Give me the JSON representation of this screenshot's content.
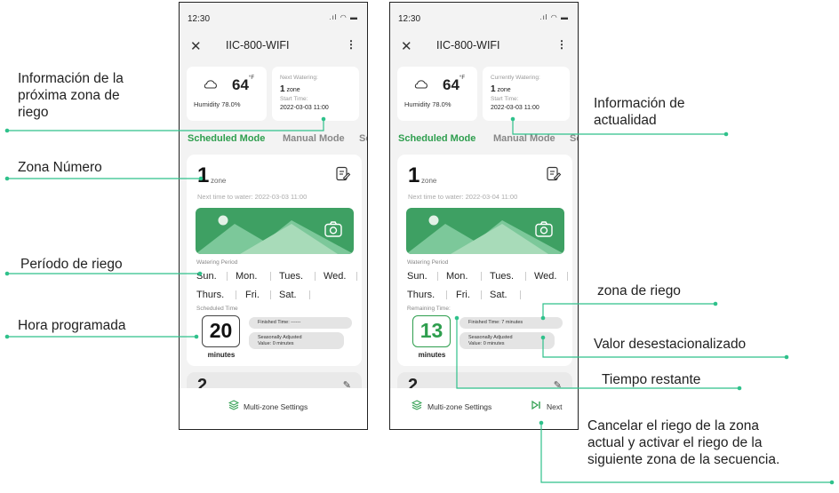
{
  "colors": {
    "accent_green": "#2e9e4e",
    "callout_line": "#2fc18b",
    "banner_green": "#3ea063"
  },
  "app": {
    "title": "IIC-800-WIFI",
    "status_time": "12:30"
  },
  "weather": {
    "temp": "64",
    "unit": "°F",
    "humidity": "Humidity 78.0%"
  },
  "tabs": {
    "scheduled": "Scheduled Mode",
    "manual": "Manual Mode",
    "third": "Sch"
  },
  "days": {
    "row1": [
      "Sun.",
      "Mon.",
      "Tues.",
      "Wed."
    ],
    "row2": [
      "Thurs.",
      "Fri.",
      "Sat."
    ]
  },
  "units": {
    "zone": "zone",
    "minutes": "minutes"
  },
  "footer": {
    "multi_zone": "Multi-zone Settings",
    "next": "Next"
  },
  "screen_a": {
    "info_label": "Next Watering:",
    "zone_count": "1",
    "start_label": "Start Time:",
    "start_time": "2022-03-03 11:00",
    "zone_number": "1",
    "next_time": "Next time to water: 2022-03-03 11:00",
    "watering_period_label": "Watering Period",
    "time_label": "Scheduled Time",
    "value": "20",
    "finished": "Finished Time: ------",
    "seasonal_1": "Seasonally Adjusted",
    "seasonal_2": "Value: 0 minutes",
    "next_zone": "2"
  },
  "screen_b": {
    "info_label": "Currently Watering:",
    "zone_count": "1",
    "start_label": "Start Time:",
    "start_time": "2022-03-03 11:00",
    "zone_number": "1",
    "next_time": "Next time to water: 2022-03-04 11:00",
    "watering_period_label": "Watering Period",
    "time_label": "Remaining Time:",
    "value": "13",
    "finished": "Finished Time: 7 minutes",
    "seasonal_1": "Seasonally Adjusted",
    "seasonal_2": "Value: 0 minutes",
    "next_zone": "2"
  },
  "annotations": {
    "next_zone_info": [
      "Información de la",
      "próxima zona de",
      "riego"
    ],
    "zone_number": "Zona Número",
    "watering_period": "Período de riego",
    "scheduled_time": "Hora programada",
    "current_info": [
      "Información de",
      "actualidad"
    ],
    "zone_watering": "zona de riego",
    "deseasonalized": "Valor desestacionalizado",
    "remaining_time": "Tiempo restante",
    "cancel_next": [
      "Cancelar el riego de la zona",
      "actual y activar el riego de la",
      "siguiente zona de la secuencia."
    ]
  }
}
